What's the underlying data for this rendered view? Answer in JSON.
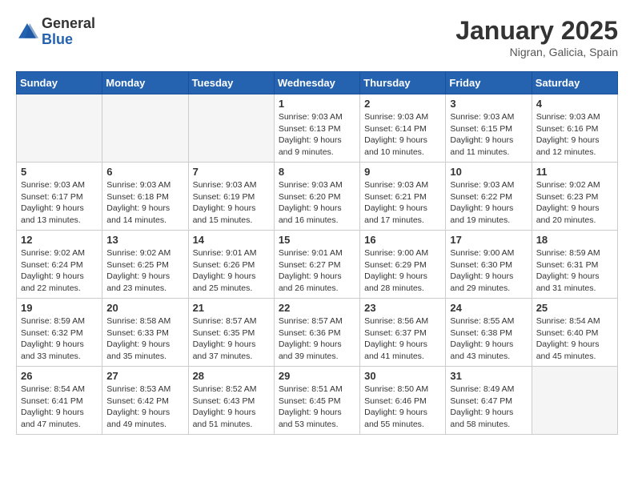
{
  "header": {
    "logo_general": "General",
    "logo_blue": "Blue",
    "month": "January 2025",
    "location": "Nigran, Galicia, Spain"
  },
  "weekdays": [
    "Sunday",
    "Monday",
    "Tuesday",
    "Wednesday",
    "Thursday",
    "Friday",
    "Saturday"
  ],
  "weeks": [
    [
      {
        "day": "",
        "empty": true
      },
      {
        "day": "",
        "empty": true
      },
      {
        "day": "",
        "empty": true
      },
      {
        "day": "1",
        "sunrise": "9:03 AM",
        "sunset": "6:13 PM",
        "daylight": "9 hours and 9 minutes."
      },
      {
        "day": "2",
        "sunrise": "9:03 AM",
        "sunset": "6:14 PM",
        "daylight": "9 hours and 10 minutes."
      },
      {
        "day": "3",
        "sunrise": "9:03 AM",
        "sunset": "6:15 PM",
        "daylight": "9 hours and 11 minutes."
      },
      {
        "day": "4",
        "sunrise": "9:03 AM",
        "sunset": "6:16 PM",
        "daylight": "9 hours and 12 minutes."
      }
    ],
    [
      {
        "day": "5",
        "sunrise": "9:03 AM",
        "sunset": "6:17 PM",
        "daylight": "9 hours and 13 minutes."
      },
      {
        "day": "6",
        "sunrise": "9:03 AM",
        "sunset": "6:18 PM",
        "daylight": "9 hours and 14 minutes."
      },
      {
        "day": "7",
        "sunrise": "9:03 AM",
        "sunset": "6:19 PM",
        "daylight": "9 hours and 15 minutes."
      },
      {
        "day": "8",
        "sunrise": "9:03 AM",
        "sunset": "6:20 PM",
        "daylight": "9 hours and 16 minutes."
      },
      {
        "day": "9",
        "sunrise": "9:03 AM",
        "sunset": "6:21 PM",
        "daylight": "9 hours and 17 minutes."
      },
      {
        "day": "10",
        "sunrise": "9:03 AM",
        "sunset": "6:22 PM",
        "daylight": "9 hours and 19 minutes."
      },
      {
        "day": "11",
        "sunrise": "9:02 AM",
        "sunset": "6:23 PM",
        "daylight": "9 hours and 20 minutes."
      }
    ],
    [
      {
        "day": "12",
        "sunrise": "9:02 AM",
        "sunset": "6:24 PM",
        "daylight": "9 hours and 22 minutes."
      },
      {
        "day": "13",
        "sunrise": "9:02 AM",
        "sunset": "6:25 PM",
        "daylight": "9 hours and 23 minutes."
      },
      {
        "day": "14",
        "sunrise": "9:01 AM",
        "sunset": "6:26 PM",
        "daylight": "9 hours and 25 minutes."
      },
      {
        "day": "15",
        "sunrise": "9:01 AM",
        "sunset": "6:27 PM",
        "daylight": "9 hours and 26 minutes."
      },
      {
        "day": "16",
        "sunrise": "9:00 AM",
        "sunset": "6:29 PM",
        "daylight": "9 hours and 28 minutes."
      },
      {
        "day": "17",
        "sunrise": "9:00 AM",
        "sunset": "6:30 PM",
        "daylight": "9 hours and 29 minutes."
      },
      {
        "day": "18",
        "sunrise": "8:59 AM",
        "sunset": "6:31 PM",
        "daylight": "9 hours and 31 minutes."
      }
    ],
    [
      {
        "day": "19",
        "sunrise": "8:59 AM",
        "sunset": "6:32 PM",
        "daylight": "9 hours and 33 minutes."
      },
      {
        "day": "20",
        "sunrise": "8:58 AM",
        "sunset": "6:33 PM",
        "daylight": "9 hours and 35 minutes."
      },
      {
        "day": "21",
        "sunrise": "8:57 AM",
        "sunset": "6:35 PM",
        "daylight": "9 hours and 37 minutes."
      },
      {
        "day": "22",
        "sunrise": "8:57 AM",
        "sunset": "6:36 PM",
        "daylight": "9 hours and 39 minutes."
      },
      {
        "day": "23",
        "sunrise": "8:56 AM",
        "sunset": "6:37 PM",
        "daylight": "9 hours and 41 minutes."
      },
      {
        "day": "24",
        "sunrise": "8:55 AM",
        "sunset": "6:38 PM",
        "daylight": "9 hours and 43 minutes."
      },
      {
        "day": "25",
        "sunrise": "8:54 AM",
        "sunset": "6:40 PM",
        "daylight": "9 hours and 45 minutes."
      }
    ],
    [
      {
        "day": "26",
        "sunrise": "8:54 AM",
        "sunset": "6:41 PM",
        "daylight": "9 hours and 47 minutes."
      },
      {
        "day": "27",
        "sunrise": "8:53 AM",
        "sunset": "6:42 PM",
        "daylight": "9 hours and 49 minutes."
      },
      {
        "day": "28",
        "sunrise": "8:52 AM",
        "sunset": "6:43 PM",
        "daylight": "9 hours and 51 minutes."
      },
      {
        "day": "29",
        "sunrise": "8:51 AM",
        "sunset": "6:45 PM",
        "daylight": "9 hours and 53 minutes."
      },
      {
        "day": "30",
        "sunrise": "8:50 AM",
        "sunset": "6:46 PM",
        "daylight": "9 hours and 55 minutes."
      },
      {
        "day": "31",
        "sunrise": "8:49 AM",
        "sunset": "6:47 PM",
        "daylight": "9 hours and 58 minutes."
      },
      {
        "day": "",
        "empty": true
      }
    ]
  ]
}
